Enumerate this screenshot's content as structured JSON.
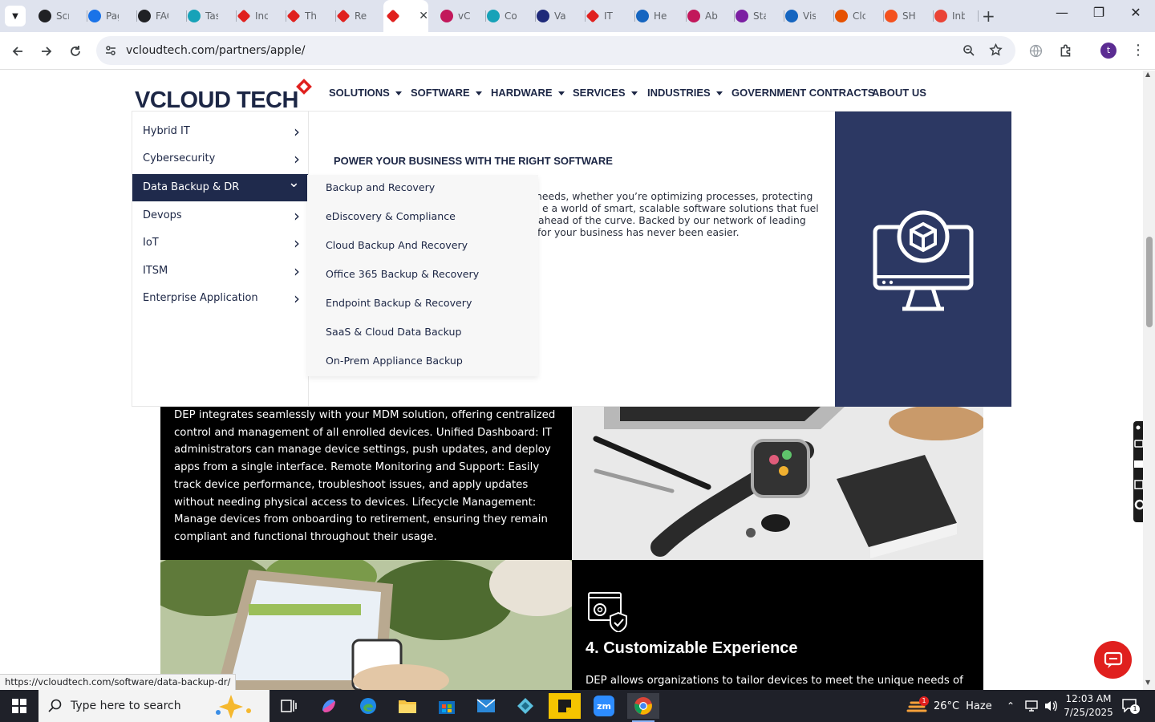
{
  "browser": {
    "tabs": [
      {
        "label": "Scr",
        "icon": "target-icon",
        "color": "#202124"
      },
      {
        "label": "Pag",
        "icon": "speed-icon",
        "color": "#1a73e8"
      },
      {
        "label": "FAQ",
        "icon": "openai-icon",
        "color": "#202124"
      },
      {
        "label": "Tas",
        "icon": "hex-icon",
        "color": "#17a2b8"
      },
      {
        "label": "Inc",
        "icon": "diamond-icon",
        "color": "#e0201e"
      },
      {
        "label": "Th",
        "icon": "diamond-icon",
        "color": "#e0201e"
      },
      {
        "label": "Re",
        "icon": "diamond-icon",
        "color": "#e0201e"
      },
      {
        "label": "",
        "icon": "diamond-icon",
        "color": "#e0201e",
        "active": true
      },
      {
        "label": "vCl",
        "icon": "v-icon",
        "color": "#c2185b"
      },
      {
        "label": "Co",
        "icon": "hex-icon",
        "color": "#17a2b8"
      },
      {
        "label": "Va",
        "icon": "x-icon",
        "color": "#1f2a7a"
      },
      {
        "label": "IT",
        "icon": "diamond-icon",
        "color": "#e0201e"
      },
      {
        "label": "He",
        "icon": "scale-icon",
        "color": "#1565c0"
      },
      {
        "label": "Ab",
        "icon": "ball-icon",
        "color": "#c2185b"
      },
      {
        "label": "Sta",
        "icon": "pen-icon",
        "color": "#7b1fa2"
      },
      {
        "label": "Vis",
        "icon": "wave-icon",
        "color": "#1565c0"
      },
      {
        "label": "Clc",
        "icon": "swoosh-icon",
        "color": "#e65100"
      },
      {
        "label": "SH",
        "icon": "ring-icon",
        "color": "#f4511e"
      },
      {
        "label": "Inb",
        "icon": "gmail-icon",
        "color": "#ea4335"
      }
    ],
    "url": "vcloudtech.com/partners/apple/",
    "avatar_letter": "t",
    "status_url": "https://vcloudtech.com/software/data-backup-dr/"
  },
  "site": {
    "logo_text": "VCLOUD TECH",
    "nav": [
      {
        "label": "SOLUTIONS",
        "dropdown": true
      },
      {
        "label": "SOFTWARE",
        "dropdown": true
      },
      {
        "label": "HARDWARE",
        "dropdown": true
      },
      {
        "label": "SERVICES",
        "dropdown": true
      },
      {
        "label": "INDUSTRIES",
        "dropdown": true
      },
      {
        "label": "GOVERNMENT CONTRACTS",
        "dropdown": false
      },
      {
        "label": "ABOUT US",
        "dropdown": false
      }
    ],
    "mega": {
      "side_items": [
        {
          "label": "Hybrid IT",
          "active": false
        },
        {
          "label": "Cybersecurity",
          "active": false
        },
        {
          "label": "Data Backup & DR",
          "active": true
        },
        {
          "label": "Devops",
          "active": false
        },
        {
          "label": "IoT",
          "active": false
        },
        {
          "label": "ITSM",
          "active": false
        },
        {
          "label": "Enterprise Application",
          "active": false
        }
      ],
      "heading": "POWER YOUR BUSINESS WITH THE RIGHT SOFTWARE",
      "paragraph_lines": [
        "needs, whether you’re optimizing processes, protecting",
        "e a world of smart, scalable software solutions that fuel",
        "ahead of the curve. Backed by our network of leading",
        "for your business has never been easier."
      ],
      "submenu": [
        "Backup and Recovery",
        "eDiscovery & Compliance",
        "Cloud Backup And Recovery",
        "Office 365 Backup & Recovery",
        "Endpoint Backup & Recovery",
        "SaaS & Cloud Data Backup",
        "On-Prem Appliance Backup"
      ]
    },
    "dep_text_lines": [
      "DEP integrates seamlessly with your MDM solution, offering centralized",
      "control and management of all enrolled devices. Unified Dashboard: IT",
      "administrators can manage device settings, push updates, and deploy",
      "apps from a single interface. Remote Monitoring and Support: Easily",
      "track device performance, troubleshoot issues, and apply updates",
      "without needing physical access to devices. Lifecycle Management:",
      "Manage devices from onboarding to retirement, ensuring they remain",
      "compliant and functional throughout their usage."
    ],
    "section4_title": "4. Customizable Experience",
    "section4_text": "DEP allows organizations to tailor devices to meet the unique needs of"
  },
  "taskbar": {
    "search_placeholder": "Type here to search",
    "temperature": "26°C",
    "weather": "Haze",
    "time": "12:03 AM",
    "date": "7/25/2025",
    "notification_count": "1",
    "weather_badge": "1"
  },
  "colors": {
    "navy": "#1c2645",
    "active_menu": "#1f2a4c",
    "panel_blue": "#2c3863",
    "brand_red": "#e0201e"
  }
}
